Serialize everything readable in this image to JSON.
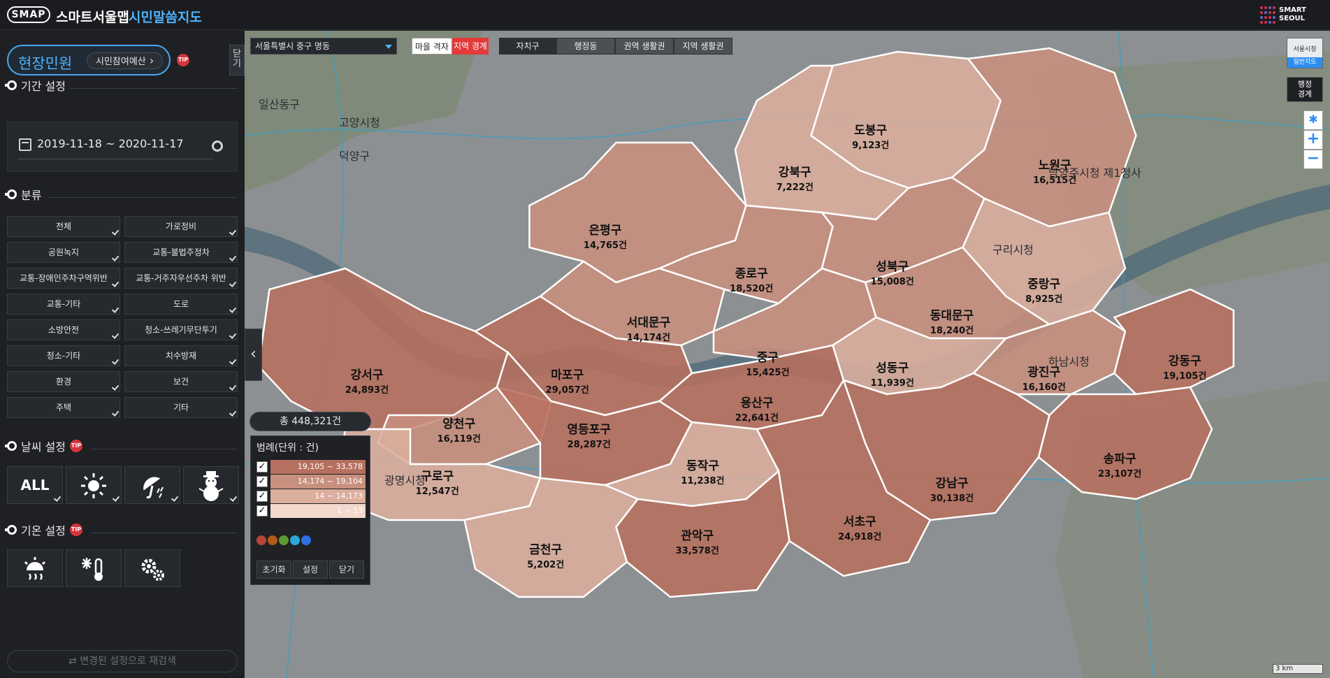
{
  "header": {
    "logo_text": "SMAP",
    "app_title": "스마트서울맵",
    "app_subtitle": "시민말씀지도",
    "brand_line1": "SMART",
    "brand_line2": "SEOUL"
  },
  "sidebar": {
    "minwon_label": "현장민원",
    "budget_button": "시민참여예산",
    "tip_label": "TIP",
    "close_tab": "닫기",
    "period_title": "기간 설정",
    "date_range": "2019-11-18 ~ 2020-11-17",
    "category_title": "분류",
    "categories": [
      {
        "label": "전체",
        "id": "all"
      },
      {
        "label": "가로정비",
        "id": "street"
      },
      {
        "label": "공원녹지",
        "id": "park"
      },
      {
        "label": "교통-불법주정차",
        "id": "parking"
      },
      {
        "label": "교통-장애인주차구역위반",
        "id": "disabled-parking"
      },
      {
        "label": "교통-거주자우선주차 위반",
        "id": "resident-parking"
      },
      {
        "label": "교통-기타",
        "id": "traffic-etc"
      },
      {
        "label": "도로",
        "id": "road"
      },
      {
        "label": "소방안전",
        "id": "fire"
      },
      {
        "label": "청소-쓰레기무단투기",
        "id": "dumping"
      },
      {
        "label": "청소-기타",
        "id": "cleaning-etc"
      },
      {
        "label": "치수방재",
        "id": "flood"
      },
      {
        "label": "환경",
        "id": "environment"
      },
      {
        "label": "보건",
        "id": "health"
      },
      {
        "label": "주택",
        "id": "housing"
      },
      {
        "label": "기타",
        "id": "etc"
      }
    ],
    "weather_title": "날씨 설정",
    "weather_all": "ALL",
    "temp_title": "기온 설정",
    "research_button": "변경된 설정으로 재검색"
  },
  "toolbar": {
    "area_select": "서울특별시 중구 명동",
    "toggle_grid": "마을 격자",
    "toggle_area": "지역 경계",
    "buttons": [
      "자치구",
      "행정동",
      "권역 생활권",
      "지역 생활권"
    ]
  },
  "map_controls": {
    "map_type_top": "서울시청",
    "map_type_bottom": "일반지도",
    "admin_border_line1": "행정",
    "admin_border_line2": "경계",
    "zoom_in": "+",
    "zoom_out": "−",
    "scale": "3 km"
  },
  "summary": {
    "total": "총 448,321건"
  },
  "legend": {
    "title": "범례(단위 : 건)",
    "ranges": [
      {
        "label": "19,105 ~ 33,578",
        "color": "#b7705f"
      },
      {
        "label": "14,174 ~ 19,104",
        "color": "#c8907e"
      },
      {
        "label": "14 ~ 14,173",
        "color": "#dcae9e"
      },
      {
        "label": "1 ~ 13",
        "color": "#f2d8cd"
      }
    ],
    "palettes": [
      "#b6453a",
      "#b15a17",
      "#5d9a36",
      "#2fa5d8",
      "#2e6fe3"
    ],
    "buttons": [
      "초기화",
      "설정",
      "닫기"
    ]
  },
  "districts": [
    {
      "name": "도봉구",
      "count": "9,123건"
    },
    {
      "name": "노원구",
      "count": "16,515건"
    },
    {
      "name": "강북구",
      "count": "7,222건"
    },
    {
      "name": "은평구",
      "count": "14,765건"
    },
    {
      "name": "종로구",
      "count": "18,520건"
    },
    {
      "name": "성북구",
      "count": "15,008건"
    },
    {
      "name": "중랑구",
      "count": "8,925건"
    },
    {
      "name": "서대문구",
      "count": "14,174건"
    },
    {
      "name": "동대문구",
      "count": "18,240건"
    },
    {
      "name": "강서구",
      "count": "24,893건"
    },
    {
      "name": "마포구",
      "count": "29,057건"
    },
    {
      "name": "중구",
      "count": "15,425건"
    },
    {
      "name": "성동구",
      "count": "11,939건"
    },
    {
      "name": "광진구",
      "count": "16,160건"
    },
    {
      "name": "강동구",
      "count": "19,105건"
    },
    {
      "name": "용산구",
      "count": "22,641건"
    },
    {
      "name": "양천구",
      "count": "16,119건"
    },
    {
      "name": "영등포구",
      "count": "28,287건"
    },
    {
      "name": "동작구",
      "count": "11,238건"
    },
    {
      "name": "구로구",
      "count": "12,547건"
    },
    {
      "name": "송파구",
      "count": "23,107건"
    },
    {
      "name": "강남구",
      "count": "30,138건"
    },
    {
      "name": "서초구",
      "count": "24,918건"
    },
    {
      "name": "관악구",
      "count": "33,578건"
    },
    {
      "name": "금천구",
      "count": "5,202건"
    }
  ],
  "background_labels": [
    "고양시청",
    "구리시청",
    "남양주시청 제1청사",
    "하남시청",
    "광명시청",
    "일산동구",
    "덕양구"
  ]
}
